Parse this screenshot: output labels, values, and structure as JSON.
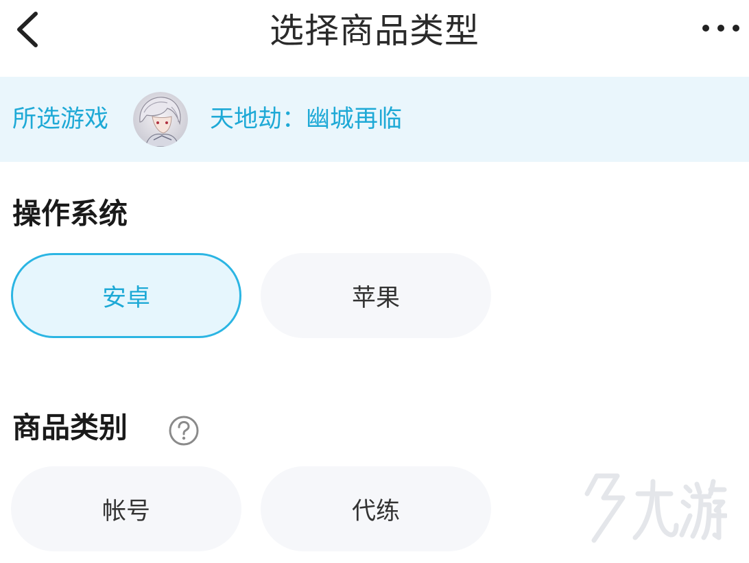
{
  "header": {
    "title": "选择商品类型",
    "back_icon": "chevron-left-icon",
    "more_icon": "more-dots-icon"
  },
  "game_bar": {
    "label": "所选游戏",
    "game_name": "天地劫：幽城再临",
    "avatar": "game-avatar-image"
  },
  "os_section": {
    "title": "操作系统",
    "options": [
      {
        "label": "安卓",
        "selected": true
      },
      {
        "label": "苹果",
        "selected": false
      }
    ]
  },
  "category_section": {
    "title": "商品类别",
    "help_icon": "question-circle-icon",
    "options": [
      {
        "label": "帐号",
        "selected": false
      },
      {
        "label": "代练",
        "selected": false
      }
    ]
  },
  "watermark": {
    "text": "九游"
  },
  "colors": {
    "accent": "#1ea9d6",
    "accent_border": "#2bb5e3",
    "game_bar_bg": "#eaf6fc",
    "pill_bg": "#f6f7fa",
    "selected_pill_bg": "#e6f6fd"
  }
}
